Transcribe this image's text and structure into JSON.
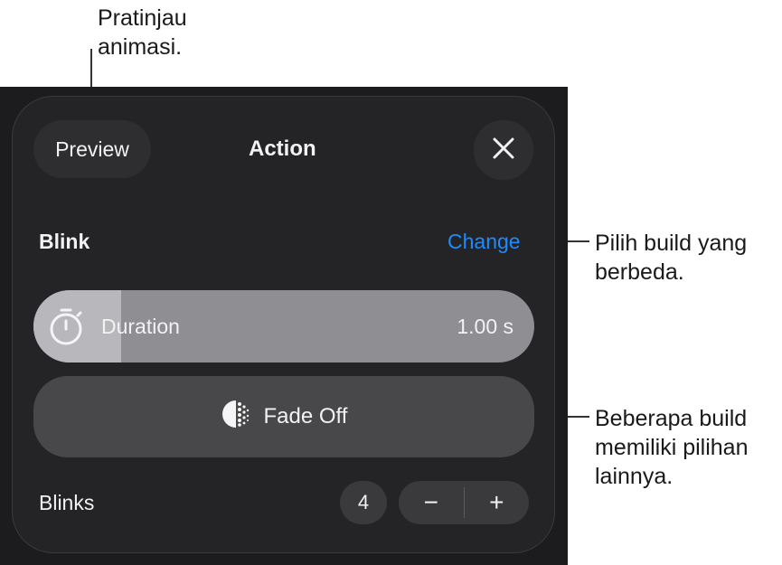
{
  "callouts": {
    "preview": "Pratinjau\nanimasi.",
    "change": "Pilih build yang\nberbeda.",
    "options": "Beberapa build\nmemiliki pilihan\nlainnya."
  },
  "header": {
    "preview_label": "Preview",
    "title": "Action",
    "close_icon": "close-icon"
  },
  "build": {
    "name": "Blink",
    "change_label": "Change",
    "link_color": "#1e8bff"
  },
  "duration": {
    "label": "Duration",
    "value": "1.00 s",
    "fill_fraction": 0.175,
    "icon": "stopwatch-icon"
  },
  "option": {
    "label": "Fade Off",
    "icon": "fade-icon"
  },
  "blinks": {
    "label": "Blinks",
    "count": "4",
    "decrement": "−",
    "increment": "+"
  }
}
